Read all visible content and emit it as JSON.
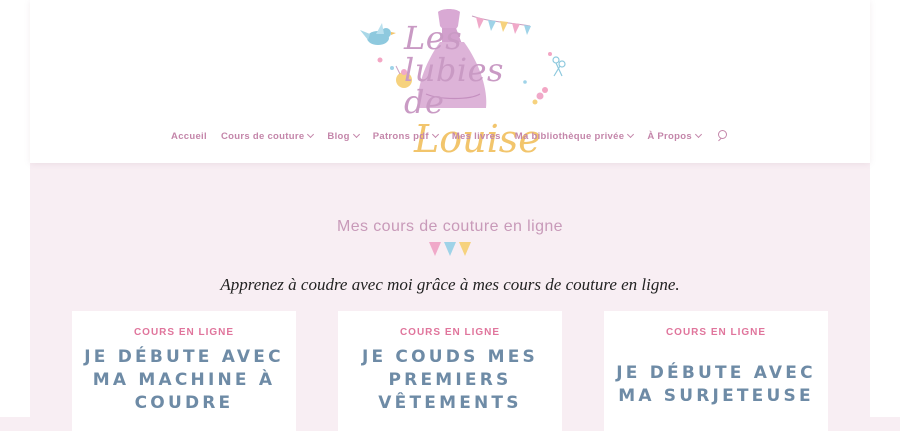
{
  "logo": {
    "line1": "Les lubies de",
    "line2": "Louise"
  },
  "nav": {
    "items": [
      {
        "label": "Accueil",
        "dropdown": false
      },
      {
        "label": "Cours de couture",
        "dropdown": true
      },
      {
        "label": "Blog",
        "dropdown": true
      },
      {
        "label": "Patrons pdf",
        "dropdown": true
      },
      {
        "label": "Mes livres",
        "dropdown": false
      },
      {
        "label": "Ma bibliothèque privée",
        "dropdown": true
      },
      {
        "label": "À Propos",
        "dropdown": true
      }
    ]
  },
  "section": {
    "title": "Mes cours de couture en ligne",
    "subtitle": "Apprenez à coudre avec moi grâce à mes cours de couture en ligne."
  },
  "cards": [
    {
      "tag": "COURS EN LIGNE",
      "title": "JE DÉBUTE AVEC MA MACHINE À COUDRE"
    },
    {
      "tag": "COURS EN LIGNE",
      "title": "JE COUDS MES PREMIERS VÊTEMENTS"
    },
    {
      "tag": "COURS EN LIGNE",
      "title": "JE DÉBUTE AVEC MA SURJETEUSE"
    }
  ],
  "colors": {
    "page_bg": "#f8eef3",
    "nav_text": "#c486aa",
    "title_text": "#c89ab9",
    "card_tag": "#e0759c",
    "card_title": "#6e8ba6",
    "bunting": [
      "#f0a9c9",
      "#9fd3e8",
      "#f6d27e"
    ]
  },
  "icons": [
    "bird-icon",
    "dress-icon",
    "bunting-icon",
    "scissors-icon",
    "search-icon",
    "chevron-down-icon"
  ]
}
